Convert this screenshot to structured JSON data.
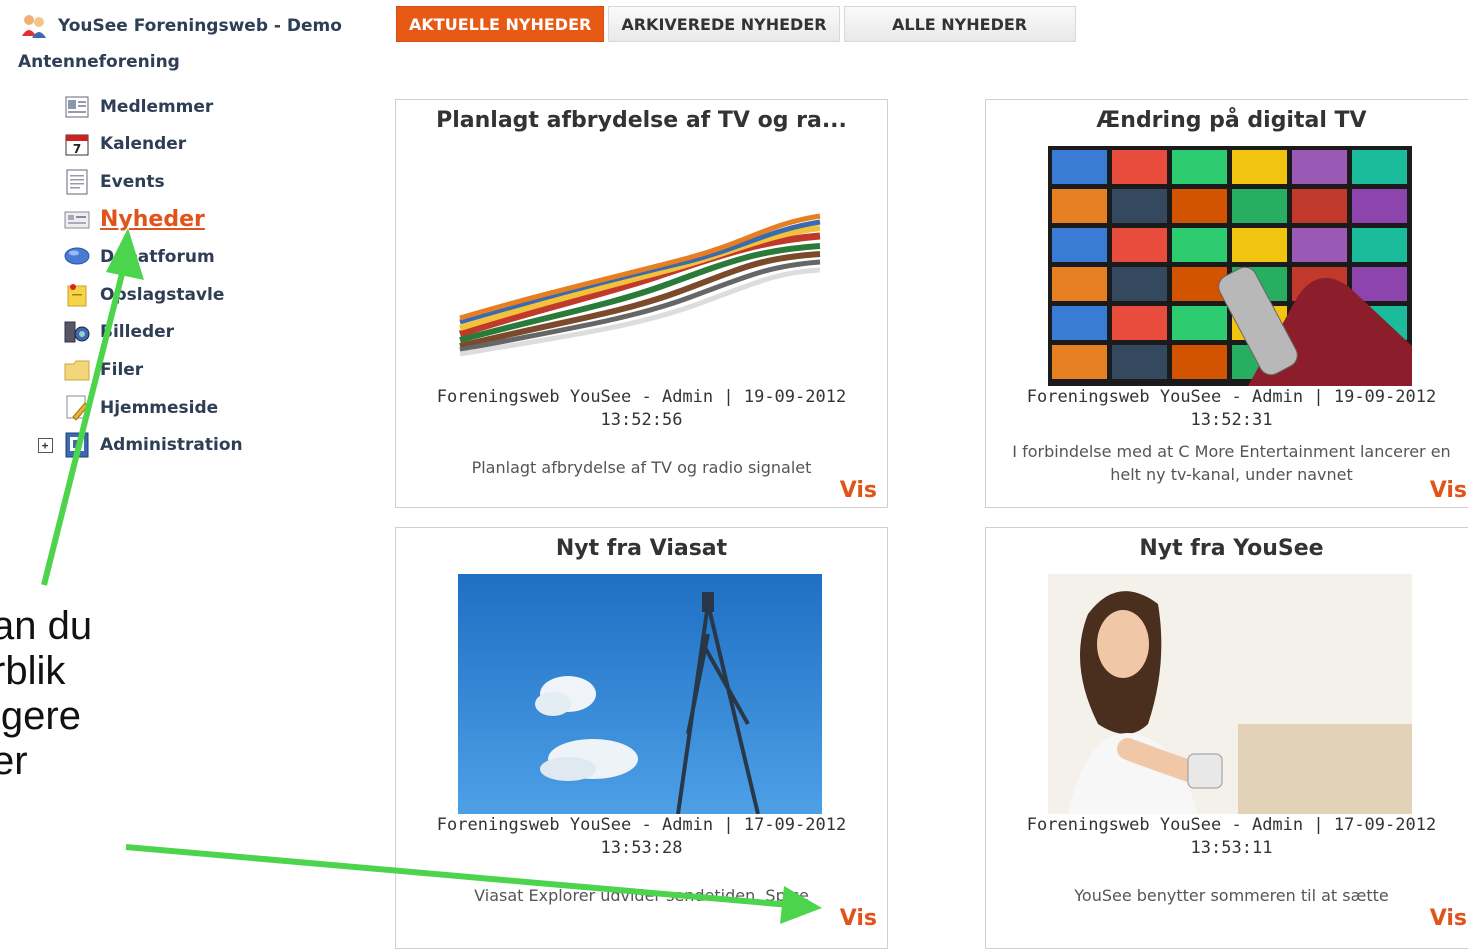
{
  "sidebar": {
    "app_title": "YouSee Foreningsweb - Demo",
    "org": "Antenneforening",
    "items": [
      {
        "label": "Medlemmer",
        "icon": "members-icon"
      },
      {
        "label": "Kalender",
        "icon": "calendar-icon"
      },
      {
        "label": "Events",
        "icon": "events-icon"
      },
      {
        "label": "Nyheder",
        "icon": "news-icon",
        "active": true
      },
      {
        "label": "Debatforum",
        "icon": "forum-icon"
      },
      {
        "label": "Opslagstavle",
        "icon": "bulletin-icon"
      },
      {
        "label": "Billeder",
        "icon": "pictures-icon"
      },
      {
        "label": "Filer",
        "icon": "files-icon"
      },
      {
        "label": "Hjemmeside",
        "icon": "homepage-icon"
      },
      {
        "label": "Administration",
        "icon": "admin-icon",
        "expandable": true
      }
    ]
  },
  "tabs": [
    {
      "label": "AKTUELLE NYHEDER",
      "active": true
    },
    {
      "label": "ARKIVEREDE NYHEDER"
    },
    {
      "label": "ALLE NYHEDER"
    }
  ],
  "news": [
    {
      "title": "Planlagt afbrydelse af TV og ra...",
      "meta_line1": "Foreningsweb YouSee - Admin | 19-09-2012",
      "meta_line2": "13:52:56",
      "excerpt": "Planlagt afbrydelse af TV og radio signalet",
      "link": "Vis",
      "image": "cables-image"
    },
    {
      "title": "Ændring på digital TV",
      "meta_line1": "Foreningsweb YouSee - Admin | 19-09-2012",
      "meta_line2": "13:52:31",
      "excerpt": "I forbindelse med at C More Entertainment lancerer en helt ny tv-kanal, under navnet",
      "link": "Vis",
      "image": "tv-wall-image"
    },
    {
      "title": "Nyt fra Viasat",
      "meta_line1": "Foreningsweb YouSee - Admin | 17-09-2012",
      "meta_line2": "13:53:28",
      "excerpt": "Viasat Explorer udvider sendetiden. Spice",
      "link": "Vis",
      "image": "antenna-sky-image"
    },
    {
      "title": "Nyt fra YouSee",
      "meta_line1": "Foreningsweb YouSee - Admin | 17-09-2012",
      "meta_line2": "13:53:11",
      "excerpt": "YouSee benytter sommeren til at sætte",
      "link": "Vis",
      "image": "woman-remote-image"
    }
  ],
  "annotation": {
    "lines": [
      "an du",
      "rblik",
      "igere",
      "er"
    ]
  },
  "colors": {
    "accent": "#e65a16",
    "arrow": "#4cd44c",
    "nav_text": "#2e3e55"
  }
}
